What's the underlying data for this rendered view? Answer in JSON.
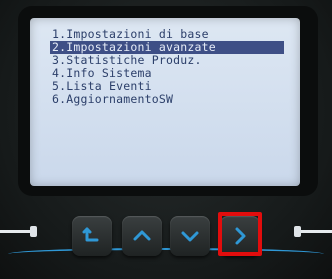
{
  "menu": {
    "items": [
      {
        "label": "1.Impostazioni di base",
        "selected": false
      },
      {
        "label": "2.Impostazioni avanzate",
        "selected": true
      },
      {
        "label": "3.Statistiche Produz.",
        "selected": false
      },
      {
        "label": "4.Info Sistema",
        "selected": false
      },
      {
        "label": "5.Lista Eventi",
        "selected": false
      },
      {
        "label": "6.AggiornamentoSW",
        "selected": false
      }
    ]
  },
  "buttons": [
    {
      "name": "back-button",
      "icon": "back-arrow-icon"
    },
    {
      "name": "up-button",
      "icon": "chevron-up-icon"
    },
    {
      "name": "down-button",
      "icon": "chevron-down-icon"
    },
    {
      "name": "enter-button",
      "icon": "chevron-right-icon",
      "highlighted": true
    }
  ],
  "colors": {
    "screen_bg": "#d5e1f0",
    "menu_text": "#2c3f6a",
    "selected_bg": "#3e4f86",
    "button_icon": "#2f98d6",
    "highlight": "#e20d0d"
  }
}
